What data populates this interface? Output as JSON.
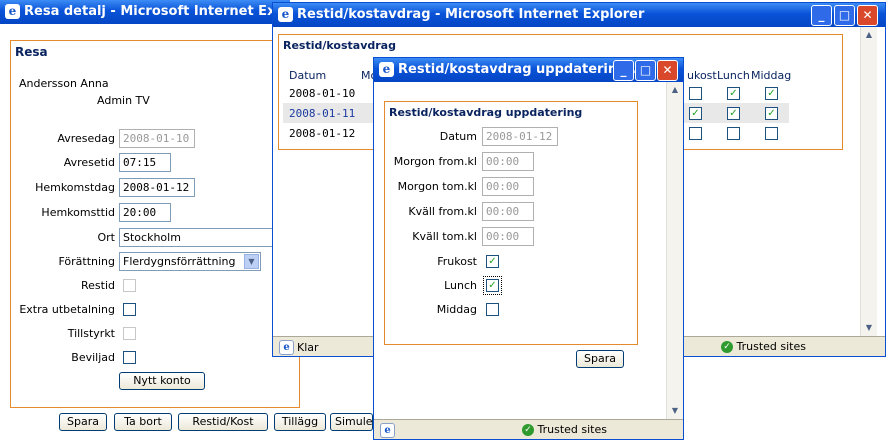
{
  "win1": {
    "title": "Resa detalj - Microsoft Internet Explorer",
    "section_title": "Resa",
    "person_name": "Andersson Anna",
    "org": "Admin TV",
    "fields": {
      "avresedag_label": "Avresedag",
      "avresedag_value": "2008-01-10",
      "avresetid_label": "Avresetid",
      "avresetid_value": "07:15",
      "hemkomstdag_label": "Hemkomstdag",
      "hemkomstdag_value": "2008-01-12",
      "hemkomsttid_label": "Hemkomsttid",
      "hemkomsttid_value": "20:00",
      "ort_label": "Ort",
      "ort_value": "Stockholm",
      "forattning_label": "Förättning",
      "forattning_value": "Flerdygnsförrättning",
      "restid_label": "Restid",
      "extra_label": "Extra utbetalning",
      "tillstyrkt_label": "Tillstyrkt",
      "beviljad_label": "Beviljad"
    },
    "nytt_konto": "Nytt konto",
    "buttons": {
      "spara": "Spara",
      "ta_bort": "Ta bort",
      "restid_kost": "Restid/Kost",
      "tillagg": "Tillägg",
      "simul": "Simule"
    }
  },
  "win2": {
    "title": "Restid/kostavdrag - Microsoft Internet Explorer",
    "section_title": "Restid/kostavdrag",
    "headers": {
      "datum": "Datum",
      "mo": "Mo",
      "frukost": "ukost",
      "lunch": "Lunch",
      "middag": "Middag"
    },
    "rows": [
      {
        "datum": "2008-01-10",
        "frukost": false,
        "lunch": true,
        "middag": true
      },
      {
        "datum": "2008-01-11",
        "frukost": true,
        "lunch": true,
        "middag": true
      },
      {
        "datum": "2008-01-12",
        "frukost": false,
        "lunch": false,
        "middag": false
      }
    ],
    "status_text": "Klar",
    "zone": "Trusted sites"
  },
  "win3": {
    "title": "Restid/kostavdrag uppdatering ...",
    "section_title": "Restid/kostavdrag uppdatering",
    "fields": {
      "datum_label": "Datum",
      "datum_value": "2008-01-12",
      "morgon_from_label": "Morgon from.kl",
      "morgon_from_value": "00:00",
      "morgon_tom_label": "Morgon tom.kl",
      "morgon_tom_value": "00:00",
      "kvall_from_label": "Kväll from.kl",
      "kvall_from_value": "00:00",
      "kvall_tom_label": "Kväll tom.kl",
      "kvall_tom_value": "00:00",
      "frukost_label": "Frukost",
      "lunch_label": "Lunch",
      "middag_label": "Middag"
    },
    "spara": "Spara",
    "zone": "Trusted sites"
  },
  "icons": {
    "ie": "e",
    "min": "_",
    "max": "□",
    "close": "✕",
    "check": "✓"
  }
}
